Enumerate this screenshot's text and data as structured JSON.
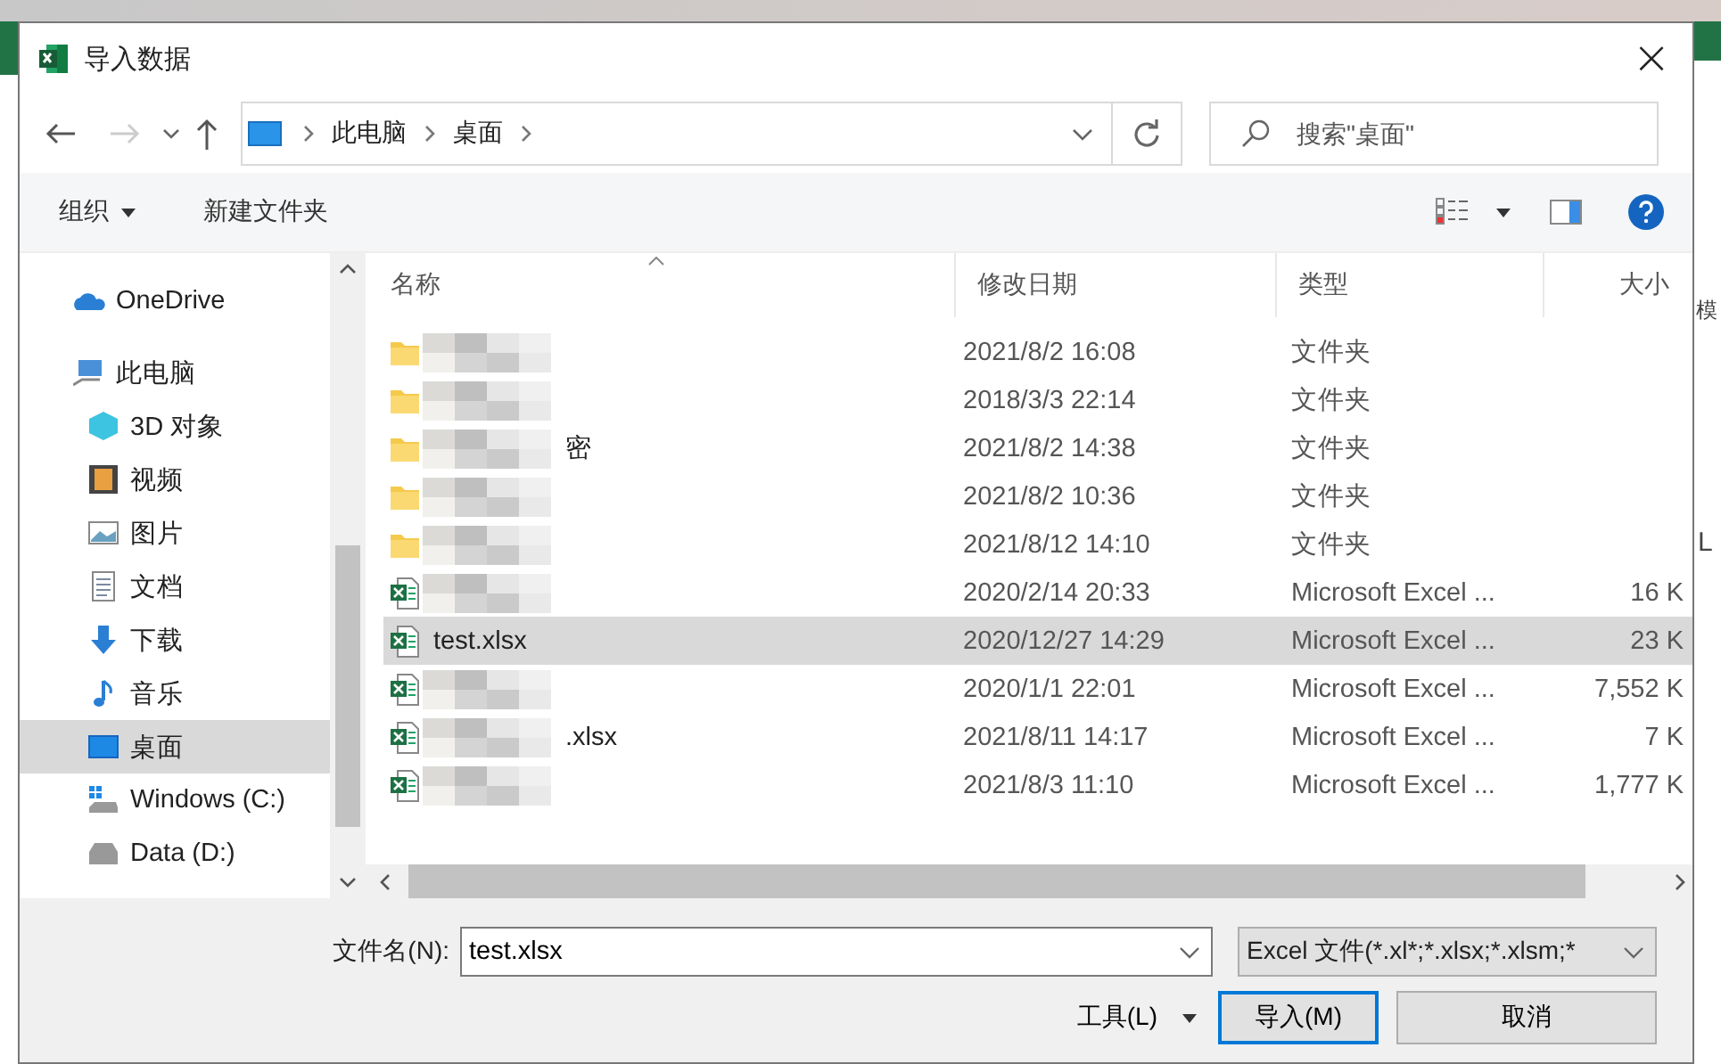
{
  "window": {
    "title": "导入数据",
    "close": "×"
  },
  "background_fragments": [
    "模",
    "L"
  ],
  "address": {
    "crumbs": [
      "此电脑",
      "桌面"
    ]
  },
  "search": {
    "placeholder": "搜索\"桌面\""
  },
  "toolbar": {
    "organize": "组织",
    "new_folder": "新建文件夹"
  },
  "nav": [
    {
      "label": "OneDrive",
      "kind": "cloud",
      "selected": false
    },
    {
      "label": "此电脑",
      "kind": "pc",
      "selected": false,
      "children": [
        {
          "label": "3D 对象",
          "kind": "cube",
          "selected": false
        },
        {
          "label": "视频",
          "kind": "film",
          "selected": false
        },
        {
          "label": "图片",
          "kind": "image",
          "selected": false
        },
        {
          "label": "文档",
          "kind": "doc",
          "selected": false
        },
        {
          "label": "下载",
          "kind": "download",
          "selected": false
        },
        {
          "label": "音乐",
          "kind": "music",
          "selected": false
        },
        {
          "label": "桌面",
          "kind": "desktop",
          "selected": true
        },
        {
          "label": "Windows (C:)",
          "kind": "windrive",
          "selected": false
        },
        {
          "label": "Data (D:)",
          "kind": "drive",
          "selected": false
        }
      ]
    }
  ],
  "table": {
    "columns": [
      "名称",
      "修改日期",
      "类型",
      "大小"
    ],
    "rows": [
      {
        "kind": "folder",
        "redacted": true,
        "date": "2021/8/2 16:08",
        "type": "文件夹",
        "selected": false
      },
      {
        "kind": "folder",
        "redacted": true,
        "date": "2018/3/3 22:14",
        "type": "文件夹",
        "selected": false
      },
      {
        "kind": "folder",
        "redacted": true,
        "name": "密",
        "date": "2021/8/2 14:38",
        "type": "文件夹",
        "selected": false
      },
      {
        "kind": "folder",
        "redacted": true,
        "date": "2021/8/2 10:36",
        "type": "文件夹",
        "selected": false
      },
      {
        "kind": "folder",
        "redacted": true,
        "date": "2021/8/12 14:10",
        "type": "文件夹",
        "selected": false
      },
      {
        "kind": "excel",
        "redacted": true,
        "date": "2020/2/14 20:33",
        "type": "Microsoft Excel ...",
        "size": "16 K",
        "selected": false
      },
      {
        "kind": "excel",
        "redacted": false,
        "name": "test.xlsx",
        "date": "2020/12/27 14:29",
        "type": "Microsoft Excel ...",
        "size": "23 K",
        "selected": true
      },
      {
        "kind": "excel",
        "redacted": true,
        "date": "2020/1/1 22:01",
        "type": "Microsoft Excel ...",
        "size": "7,552 K",
        "selected": false
      },
      {
        "kind": "excel",
        "redacted": true,
        "name": ".xlsx",
        "date": "2021/8/11 14:17",
        "type": "Microsoft Excel ...",
        "size": "7 K",
        "selected": false
      },
      {
        "kind": "excel",
        "redacted": true,
        "date": "2021/8/3 11:10",
        "type": "Microsoft Excel ...",
        "size": "1,777 K",
        "selected": false
      }
    ]
  },
  "filename": {
    "label": "文件名(N):",
    "value": "test.xlsx"
  },
  "filter": {
    "value": "Excel 文件(*.xl*;*.xlsx;*.xlsm;*"
  },
  "buttons": {
    "tools": "工具(L)",
    "import": "导入(M)",
    "cancel": "取消"
  }
}
